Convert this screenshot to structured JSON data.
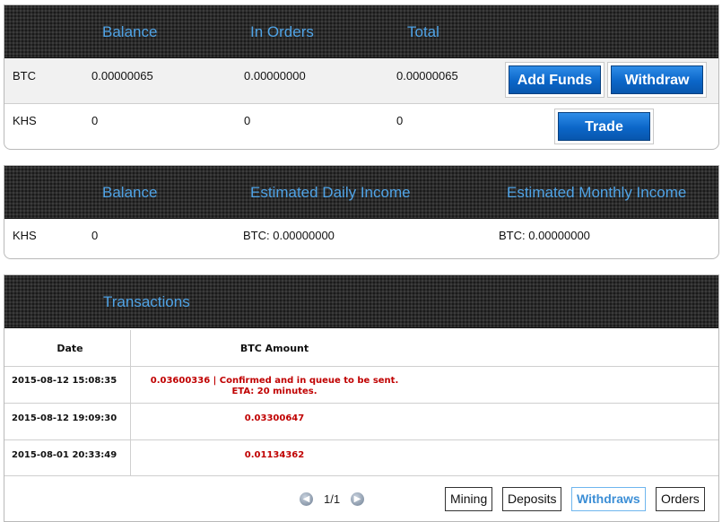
{
  "balances": {
    "headers": {
      "balance": "Balance",
      "in_orders": "In Orders",
      "total": "Total"
    },
    "rows": [
      {
        "currency": "BTC",
        "balance": "0.00000065",
        "in_orders": "0.00000000",
        "total": "0.00000065"
      },
      {
        "currency": "KHS",
        "balance": "0",
        "in_orders": "0",
        "total": "0"
      }
    ],
    "add_funds_label": "Add Funds",
    "withdraw_label": "Withdraw",
    "trade_label": "Trade"
  },
  "income": {
    "headers": {
      "balance": "Balance",
      "daily": "Estimated Daily Income",
      "monthly": "Estimated Monthly Income"
    },
    "row": {
      "currency": "KHS",
      "balance": "0",
      "daily": "BTC: 0.00000000",
      "monthly": "BTC: 0.00000000"
    }
  },
  "transactions": {
    "title": "Transactions",
    "columns": {
      "date": "Date",
      "amount": "BTC Amount"
    },
    "rows": [
      {
        "date": "2015-08-12 15:08:35",
        "amount": "0.03600336 | Confirmed and in queue to be sent.",
        "note": "ETA: 20 minutes."
      },
      {
        "date": "2015-08-12 19:09:30",
        "amount": "0.03300647"
      },
      {
        "date": "2015-08-01 20:33:49",
        "amount": "0.01134362"
      }
    ],
    "pagination": {
      "page": "1/1",
      "prev_icon": "prev-arrow-icon",
      "next_icon": "next-arrow-icon"
    },
    "filters": {
      "mining": "Mining",
      "deposits": "Deposits",
      "withdraws": "Withdraws",
      "orders": "Orders"
    },
    "active_filter": "Withdraws"
  },
  "colors": {
    "header_text": "#4fa3e6",
    "amount_red": "#c00000",
    "button_blue": "#0b66c8"
  }
}
